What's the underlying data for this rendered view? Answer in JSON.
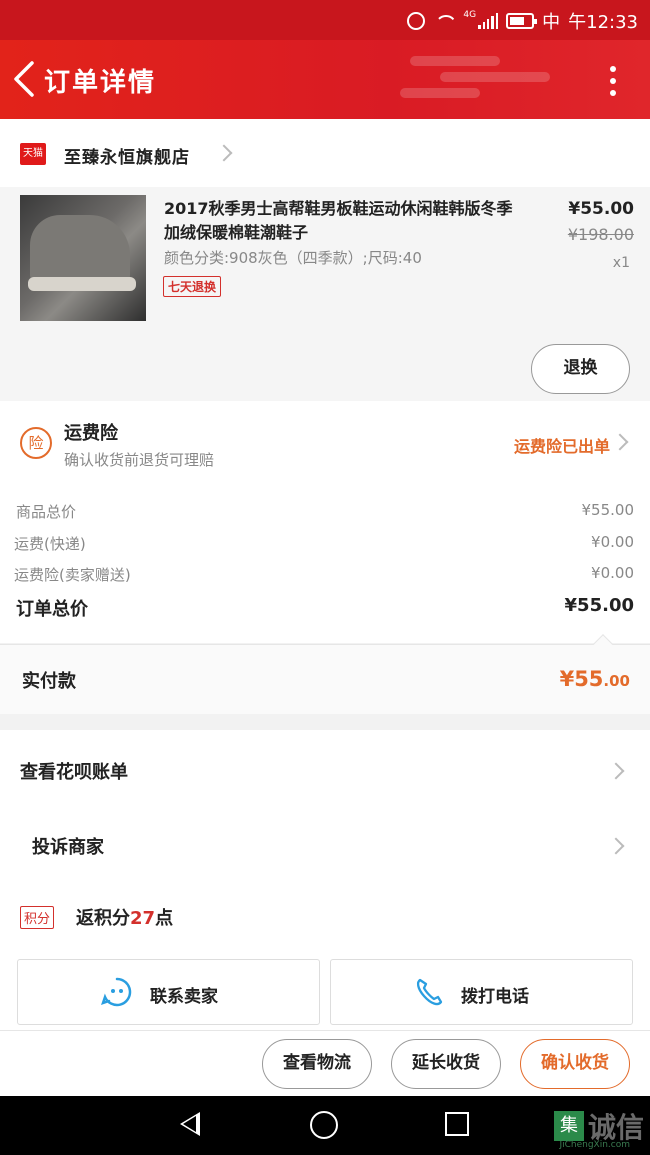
{
  "status_bar": {
    "network_label": "4G",
    "carrier": "中",
    "time": "午12:33"
  },
  "header": {
    "title": "订单详情"
  },
  "store": {
    "badge": "天猫",
    "name": "至臻永恒旗舰店"
  },
  "product": {
    "title": "2017秋季男士高帮鞋男板鞋运动休闲鞋韩版冬季加绒保暖棉鞋潮鞋子",
    "sku": "颜色分类:908灰色（四季款）;尺码:40",
    "tag": "七天退换",
    "price": "¥55.00",
    "original_price": "¥198.00",
    "quantity": "x1",
    "refund_label": "退换"
  },
  "insurance": {
    "icon_text": "险",
    "title": "运费险",
    "subtitle": "确认收货前退货可理赔",
    "status": "运费险已出单"
  },
  "summary": {
    "rows": [
      {
        "label": "商品总价",
        "value": "¥55.00"
      },
      {
        "label": "运费(快递)",
        "value": "¥0.00"
      },
      {
        "label": "运费险(卖家赠送)",
        "value": "¥0.00"
      }
    ],
    "total_label": "订单总价",
    "total_value": "¥55.00"
  },
  "payment": {
    "label": "实付款",
    "value_main": "¥55",
    "value_decimal": ".00"
  },
  "menu": {
    "huabei": "查看花呗账单",
    "complain": "投诉商家",
    "points_badge": "积分",
    "points_prefix": "返积分",
    "points_num": "27",
    "points_suffix": "点",
    "contact_seller": "联系卖家",
    "call_phone": "拨打电话"
  },
  "actions": {
    "logistics": "查看物流",
    "extend": "延长收货",
    "confirm": "确认收货"
  },
  "watermark": {
    "logo": "集",
    "text": "诚信",
    "sub": "JiChengXin.com"
  },
  "colors": {
    "brand_red": "#d91b24",
    "accent_orange": "#e36b2b",
    "points_red": "#d3302c"
  }
}
